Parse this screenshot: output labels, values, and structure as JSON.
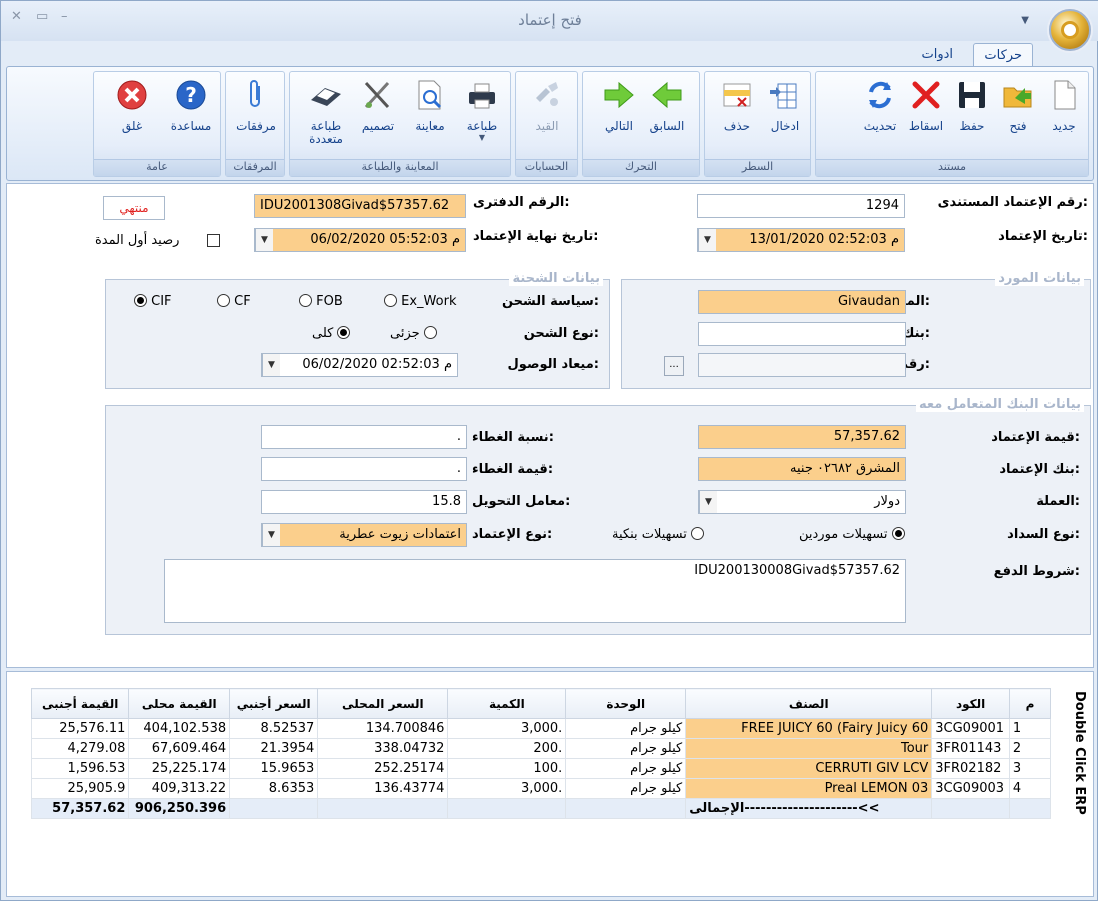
{
  "window": {
    "title": "فتح إعتماد",
    "tabs": [
      "حركات",
      "ادوات"
    ]
  },
  "ribbon": {
    "groups": {
      "document": "مستند",
      "line": "السطر",
      "navigation": "التحرك",
      "accounts": "الحسابات",
      "preview_print": "المعاينة والطباعة",
      "attachments": "المرفقات",
      "general": "عامة"
    },
    "buttons": {
      "new": "جديد",
      "open": "فتح",
      "save": "حفظ",
      "cancel": "اسقاط",
      "refresh": "تحديث",
      "insert": "ادخال",
      "delete": "حذف",
      "prev": "السابق",
      "next": "التالي",
      "entry": "القيد",
      "print": "طباعة",
      "preview": "معاينة",
      "design": "تصميم",
      "multi_print": "طباعة متعددة",
      "attachments": "مرفقات",
      "help": "مساعدة",
      "close": "غلق"
    }
  },
  "form": {
    "doc_no_label": "رقم الإعتماد المستندى:",
    "doc_no": "1294",
    "book_no_label": "الرقم الدفترى:",
    "book_no": "IDU2001308Givad$57357.62",
    "status": "منتهي",
    "date_label": "تاريخ الإعتماد:",
    "date": "13/01/2020 02:52:03 م",
    "end_date_label": "تاريخ نهاية الإعتماد:",
    "end_date": "06/02/2020 05:52:03 م",
    "opening_balance": "رصيد أول المدة",
    "supplier_legend": "بيانات المورد",
    "supplier_label": "المورد:",
    "supplier": "Givaudan",
    "supplier_bank_label": "بنك المورد:",
    "supplier_bank": "",
    "po_label": "رقم أمر الشراء:",
    "po": "",
    "po_btn": "...",
    "shipping_legend": "بيانات الشحنة",
    "ship_policy_label": "سياسة الشحن:",
    "ship_policies": [
      "Ex_Work",
      "FOB",
      "CF",
      "CIF"
    ],
    "ship_policy_selected": "CIF",
    "ship_type_label": "نوع الشحن:",
    "ship_types": [
      "جزئى",
      "كلى"
    ],
    "arrival_label": "ميعاد الوصول:",
    "arrival": "06/02/2020 02:52:03 م",
    "bank_legend": "بيانات البنك المتعامل معه",
    "amount_label": "قيمة الإعتماد:",
    "amount": "57,357.62",
    "bank_label": "بنك الإعتماد:",
    "bank": "المشرق ٠٢٦٨٢ جنيه",
    "currency_label": "العملة:",
    "currency": "دولار",
    "pay_type_label": "نوع السداد:",
    "pay_types": [
      "تسهيلات موردين",
      "تسهيلات بنكية"
    ],
    "cover_pct_label": "نسبة الغطاء:",
    "cover_pct": ".",
    "cover_val_label": "قيمة الغطاء:",
    "cover_val": ".",
    "rate_label": "معامل التحويل:",
    "rate": "15.8",
    "lc_type_label": "نوع الإعتماد:",
    "lc_type": "اعتمادات زيوت عطرية",
    "terms_label": "شروط الدفع:",
    "terms": "IDU200130008Givad$57357.62"
  },
  "grid": {
    "side_label": "Double Click ERP",
    "headers": [
      "القيمة أجنبى",
      "القيمة محلى",
      "السعر أجنبي",
      "السعر المحلى",
      "الكمية",
      "الوحدة",
      "الصنف",
      "الكود",
      "م"
    ],
    "rows": [
      [
        "25,576.11",
        "404,102.538",
        "8.52537",
        "134.700846",
        "3,000.",
        "كيلو جرام",
        "FREE JUICY 60 (Fairy Juicy 60",
        "3CG09001",
        "1"
      ],
      [
        "4,279.08",
        "67,609.464",
        "21.3954",
        "338.04732",
        "200.",
        "كيلو جرام",
        "Tour",
        "3FR01143",
        "2"
      ],
      [
        "1,596.53",
        "25,225.174",
        "15.9653",
        "252.25174",
        "100.",
        "كيلو جرام",
        "CERRUTI GIV LCV",
        "3FR02182",
        "3"
      ],
      [
        "25,905.9",
        "409,313.22",
        "8.6353",
        "136.43774",
        "3,000.",
        "كيلو جرام",
        "Preal LEMON 03",
        "3CG09003",
        "4"
      ]
    ],
    "totals": {
      "foreign": "57,357.62",
      "local": "906,250.396",
      "label": "الإجمالى---------------------<<"
    }
  }
}
